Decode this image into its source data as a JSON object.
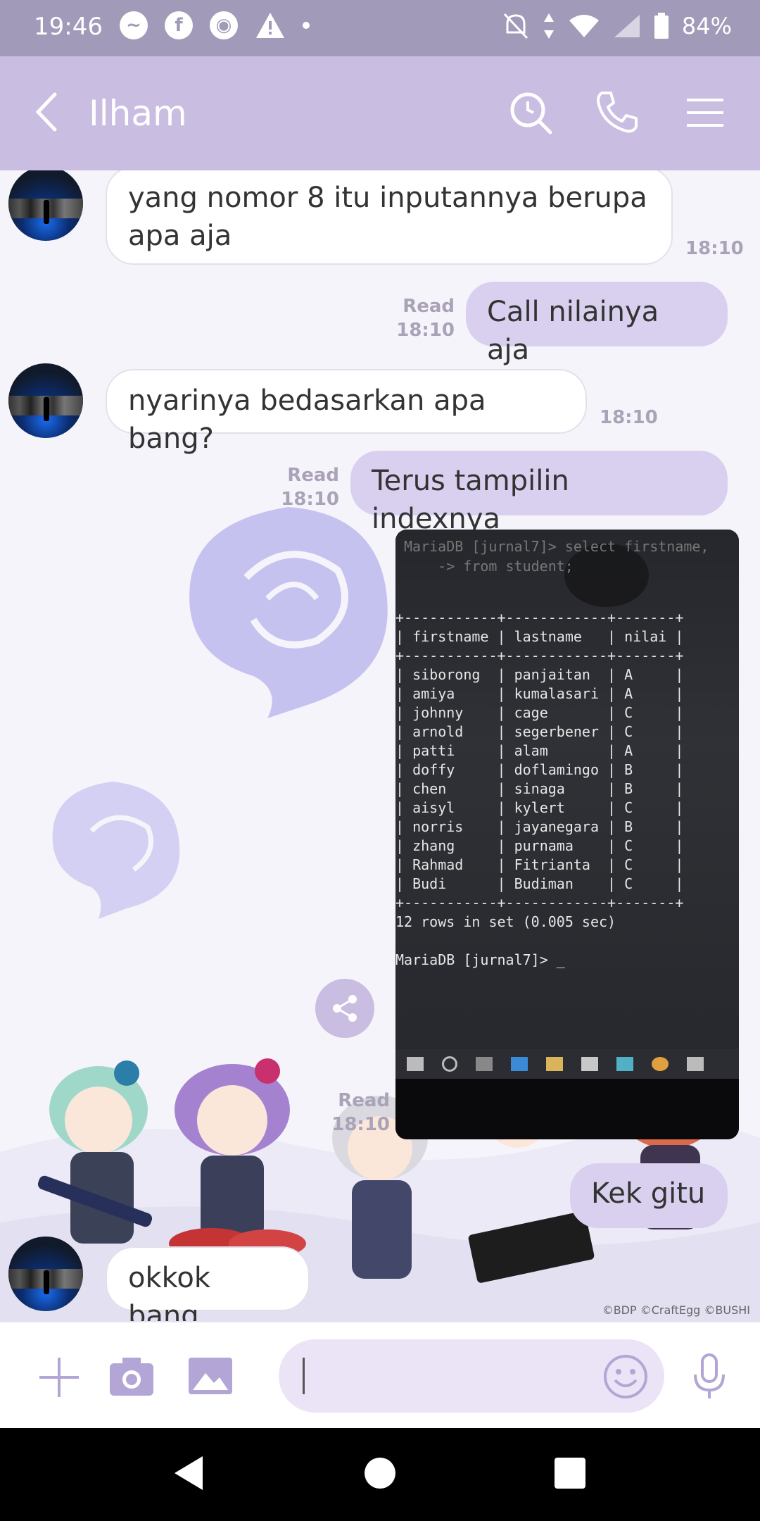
{
  "status_bar": {
    "time": "19:46",
    "battery": "84%"
  },
  "header": {
    "contact_name": "Ilham"
  },
  "messages": [
    {
      "text": "yang nomor 8 itu inputannya berupa apa aja",
      "time": "18:10"
    },
    {
      "text": "Call nilainya aja",
      "read": "Read",
      "time": "18:10"
    },
    {
      "text": "nyarinya bedasarkan apa bang?",
      "time": "18:10"
    },
    {
      "text": "Terus tampilin indexnya",
      "read": "Read",
      "time": "18:10"
    },
    {
      "read": "Read",
      "time": "18:10"
    },
    {
      "text": "Kek gitu"
    },
    {
      "text": "okkok bang"
    }
  ],
  "photo": {
    "prompt_lines": "MariaDB [jurnal7]> select firstname,\n    -> from student;",
    "table_text": "+-----------+------------+-------+\n| firstname | lastname   | nilai |\n+-----------+------------+-------+\n| siborong  | panjaitan  | A     |\n| amiya     | kumalasari | A     |\n| johnny    | cage       | C     |\n| arnold    | segerbener | C     |\n| patti     | alam       | A     |\n| doffy     | doflamingo | B     |\n| chen      | sinaga     | B     |\n| aisyl     | kylert     | C     |\n| norris    | jayanegara | B     |\n| zhang     | purnama    | C     |\n| Rahmad    | Fitrianta  | C     |\n| Budi      | Budiman    | C     |\n+-----------+------------+-------+\n12 rows in set (0.005 sec)\n\nMariaDB [jurnal7]> _"
  },
  "background": {
    "copyright": "©BDP ©CraftEgg ©BUSHI"
  },
  "input": {
    "placeholder": ""
  },
  "icons": {
    "back": "chevron-left-icon",
    "search": "search-icon",
    "call": "phone-icon",
    "menu": "menu-icon",
    "add": "plus-icon",
    "camera": "camera-icon",
    "gallery": "image-icon",
    "emoji": "emoji-icon",
    "mic": "microphone-icon",
    "share": "share-icon"
  },
  "colors": {
    "header": "#c9bde2",
    "status_bar": "#a19ab8",
    "outgoing_bubble": "#d9cfee",
    "incoming_bubble": "#ffffff",
    "accent": "#b3a6d6"
  }
}
